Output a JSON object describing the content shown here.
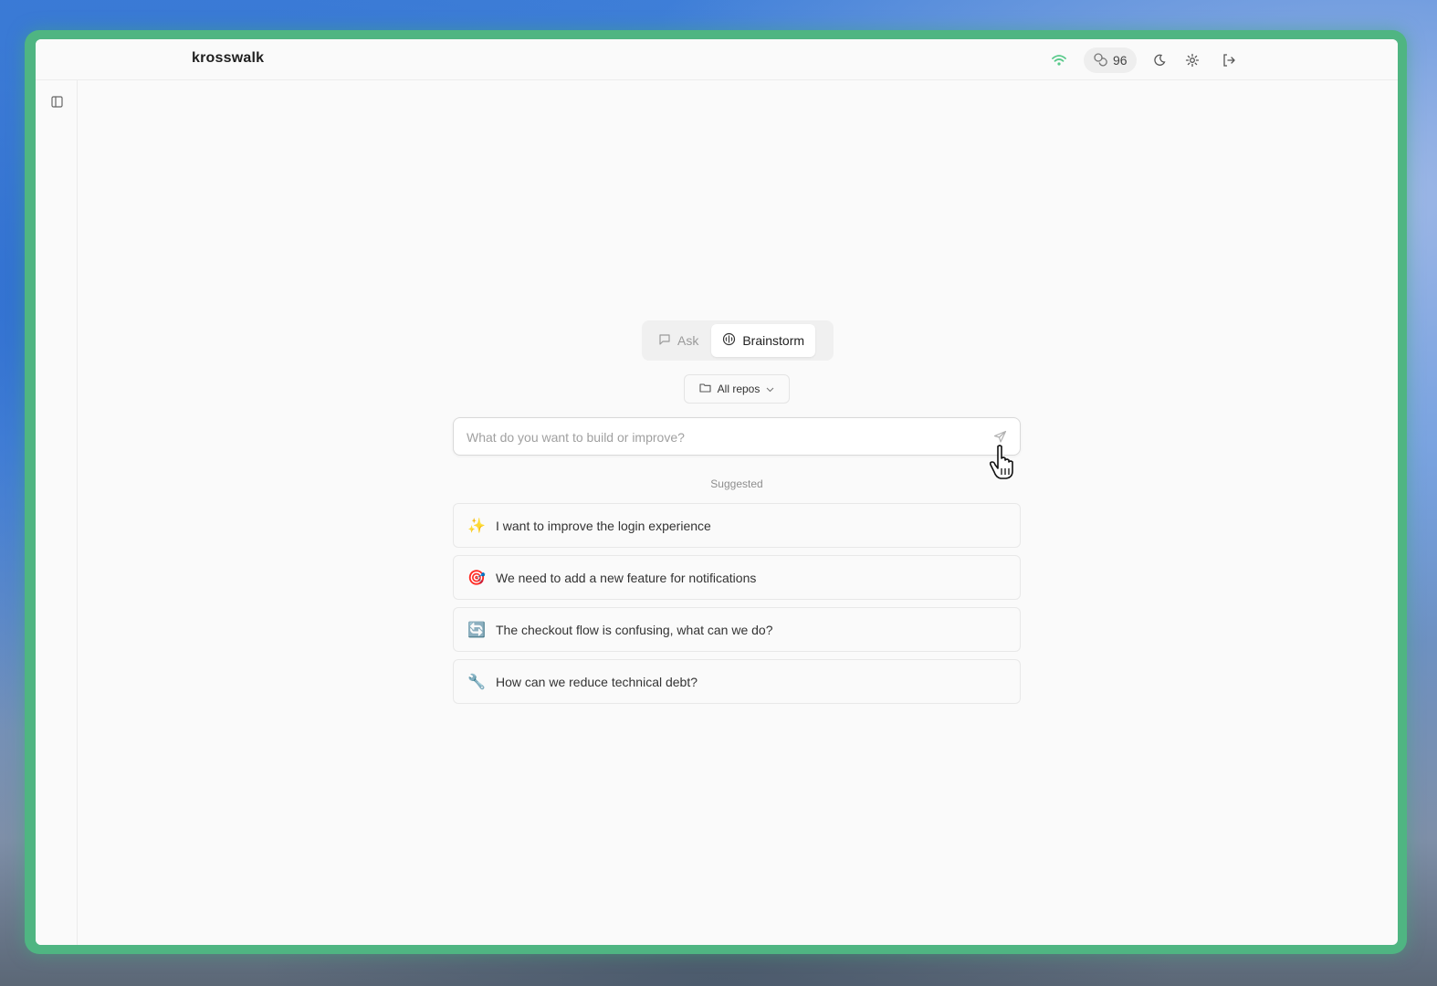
{
  "app": {
    "name": "krosswalk"
  },
  "header": {
    "credits": "96"
  },
  "modes": [
    {
      "label": "Ask",
      "icon": "chat-icon",
      "active": false
    },
    {
      "label": "Brainstorm",
      "icon": "brain-icon",
      "active": true
    }
  ],
  "repo_select": {
    "label": "All repos",
    "icon": "folder-icon"
  },
  "prompt": {
    "placeholder": "What do you want to build or improve?"
  },
  "suggested": {
    "label": "Suggested",
    "items": [
      {
        "emoji": "✨",
        "text": "I want to improve the login experience"
      },
      {
        "emoji": "🎯",
        "text": "We need to add a new feature for notifications"
      },
      {
        "emoji": "🔄",
        "text": "The checkout flow is confusing, what can we do?"
      },
      {
        "emoji": "🔧",
        "text": "How can we reduce technical debt?"
      }
    ]
  },
  "colors": {
    "frame": "#4fb582",
    "status_online": "#58c98a"
  }
}
